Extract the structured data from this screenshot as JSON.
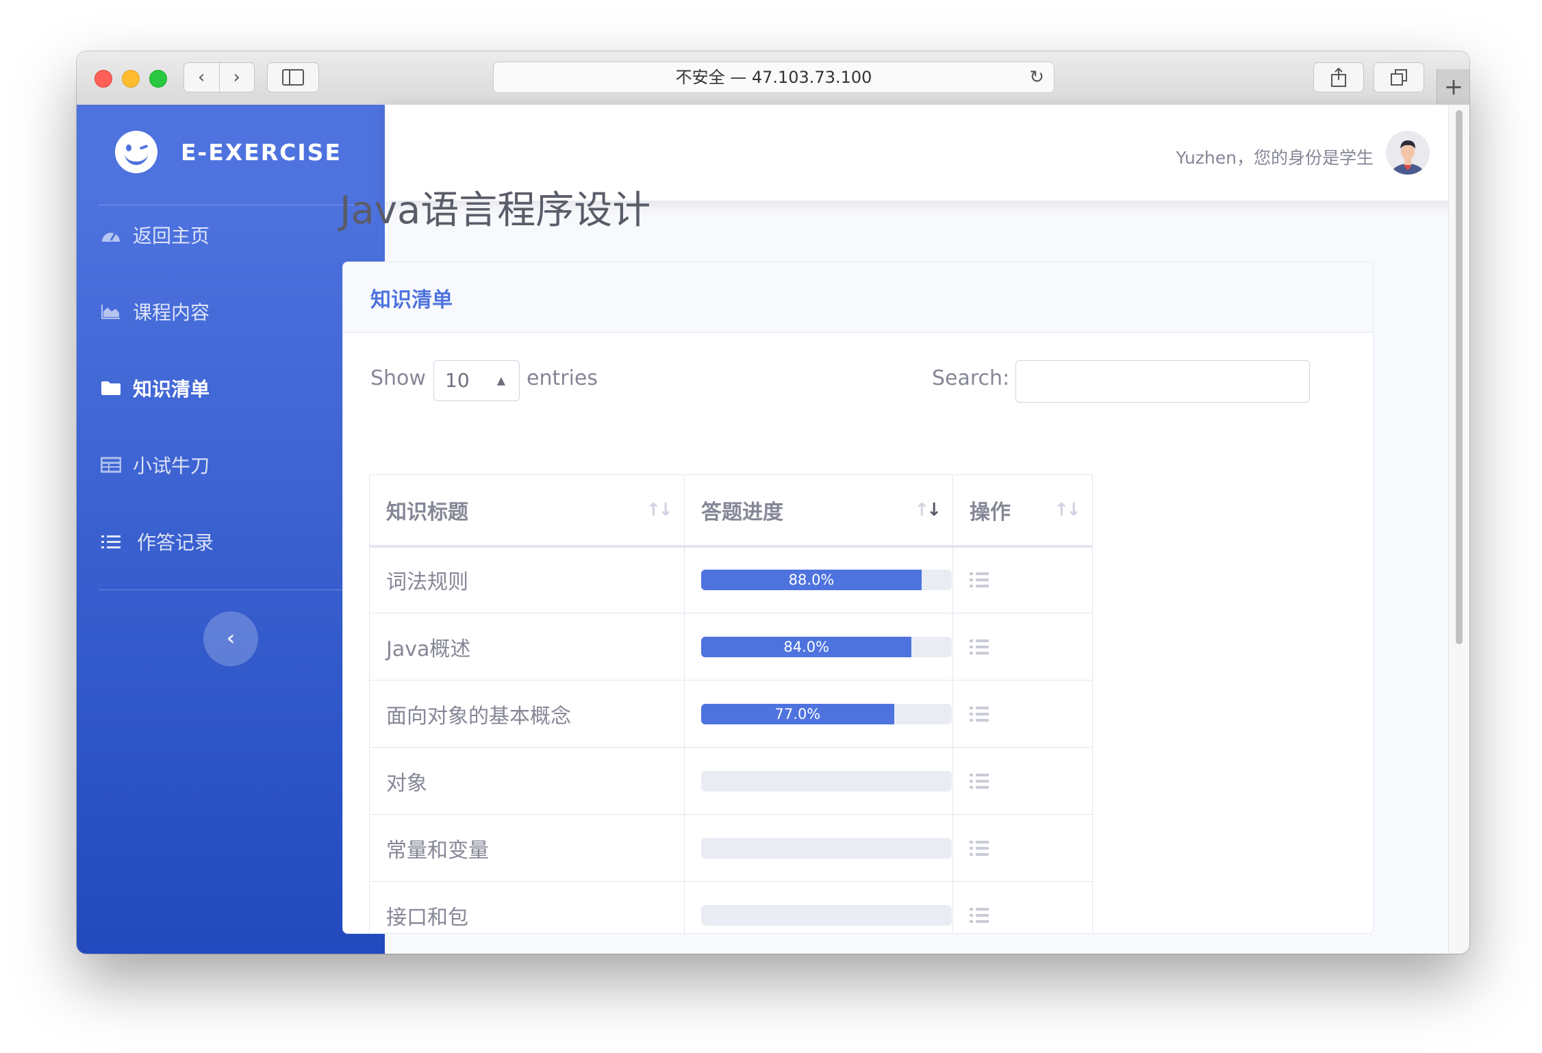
{
  "browser": {
    "url_text": "不安全 — 47.103.73.100",
    "back_glyph": "‹",
    "forward_glyph": "›",
    "reload_glyph": "↻",
    "new_tab_glyph": "+"
  },
  "sidebar": {
    "brand": "E-EXERCISE",
    "items": [
      {
        "label": "返回主页",
        "icon": "tachometer-icon"
      },
      {
        "label": "课程内容",
        "icon": "area-chart-icon"
      },
      {
        "label": "知识清单",
        "icon": "folder-icon",
        "active": true
      },
      {
        "label": "小试牛刀",
        "icon": "table-icon"
      },
      {
        "label": "作答记录",
        "icon": "list-icon"
      }
    ],
    "collapse_glyph": "‹"
  },
  "topbar": {
    "user_text": "Yuzhen，您的身份是学生"
  },
  "page": {
    "title": "Java语言程序设计"
  },
  "card": {
    "title": "知识清单",
    "show_label": "Show",
    "length_value": "10",
    "entries_label": "entries",
    "search_label": "Search:",
    "search_value": "",
    "columns": [
      "知识标题",
      "答题进度",
      "操作"
    ],
    "rows": [
      {
        "title": "词法规则",
        "progress": 88.0,
        "progress_label": "88.0%"
      },
      {
        "title": "Java概述",
        "progress": 84.0,
        "progress_label": "84.0%"
      },
      {
        "title": "面向对象的基本概念",
        "progress": 77.0,
        "progress_label": "77.0%"
      },
      {
        "title": "对象",
        "progress": 0,
        "progress_label": ""
      },
      {
        "title": "常量和变量",
        "progress": 0,
        "progress_label": ""
      },
      {
        "title": "接口和包",
        "progress": 0,
        "progress_label": ""
      }
    ]
  },
  "colors": {
    "primary": "#4e73df",
    "sidebar_bottom": "#224abe",
    "text_muted": "#858796"
  }
}
